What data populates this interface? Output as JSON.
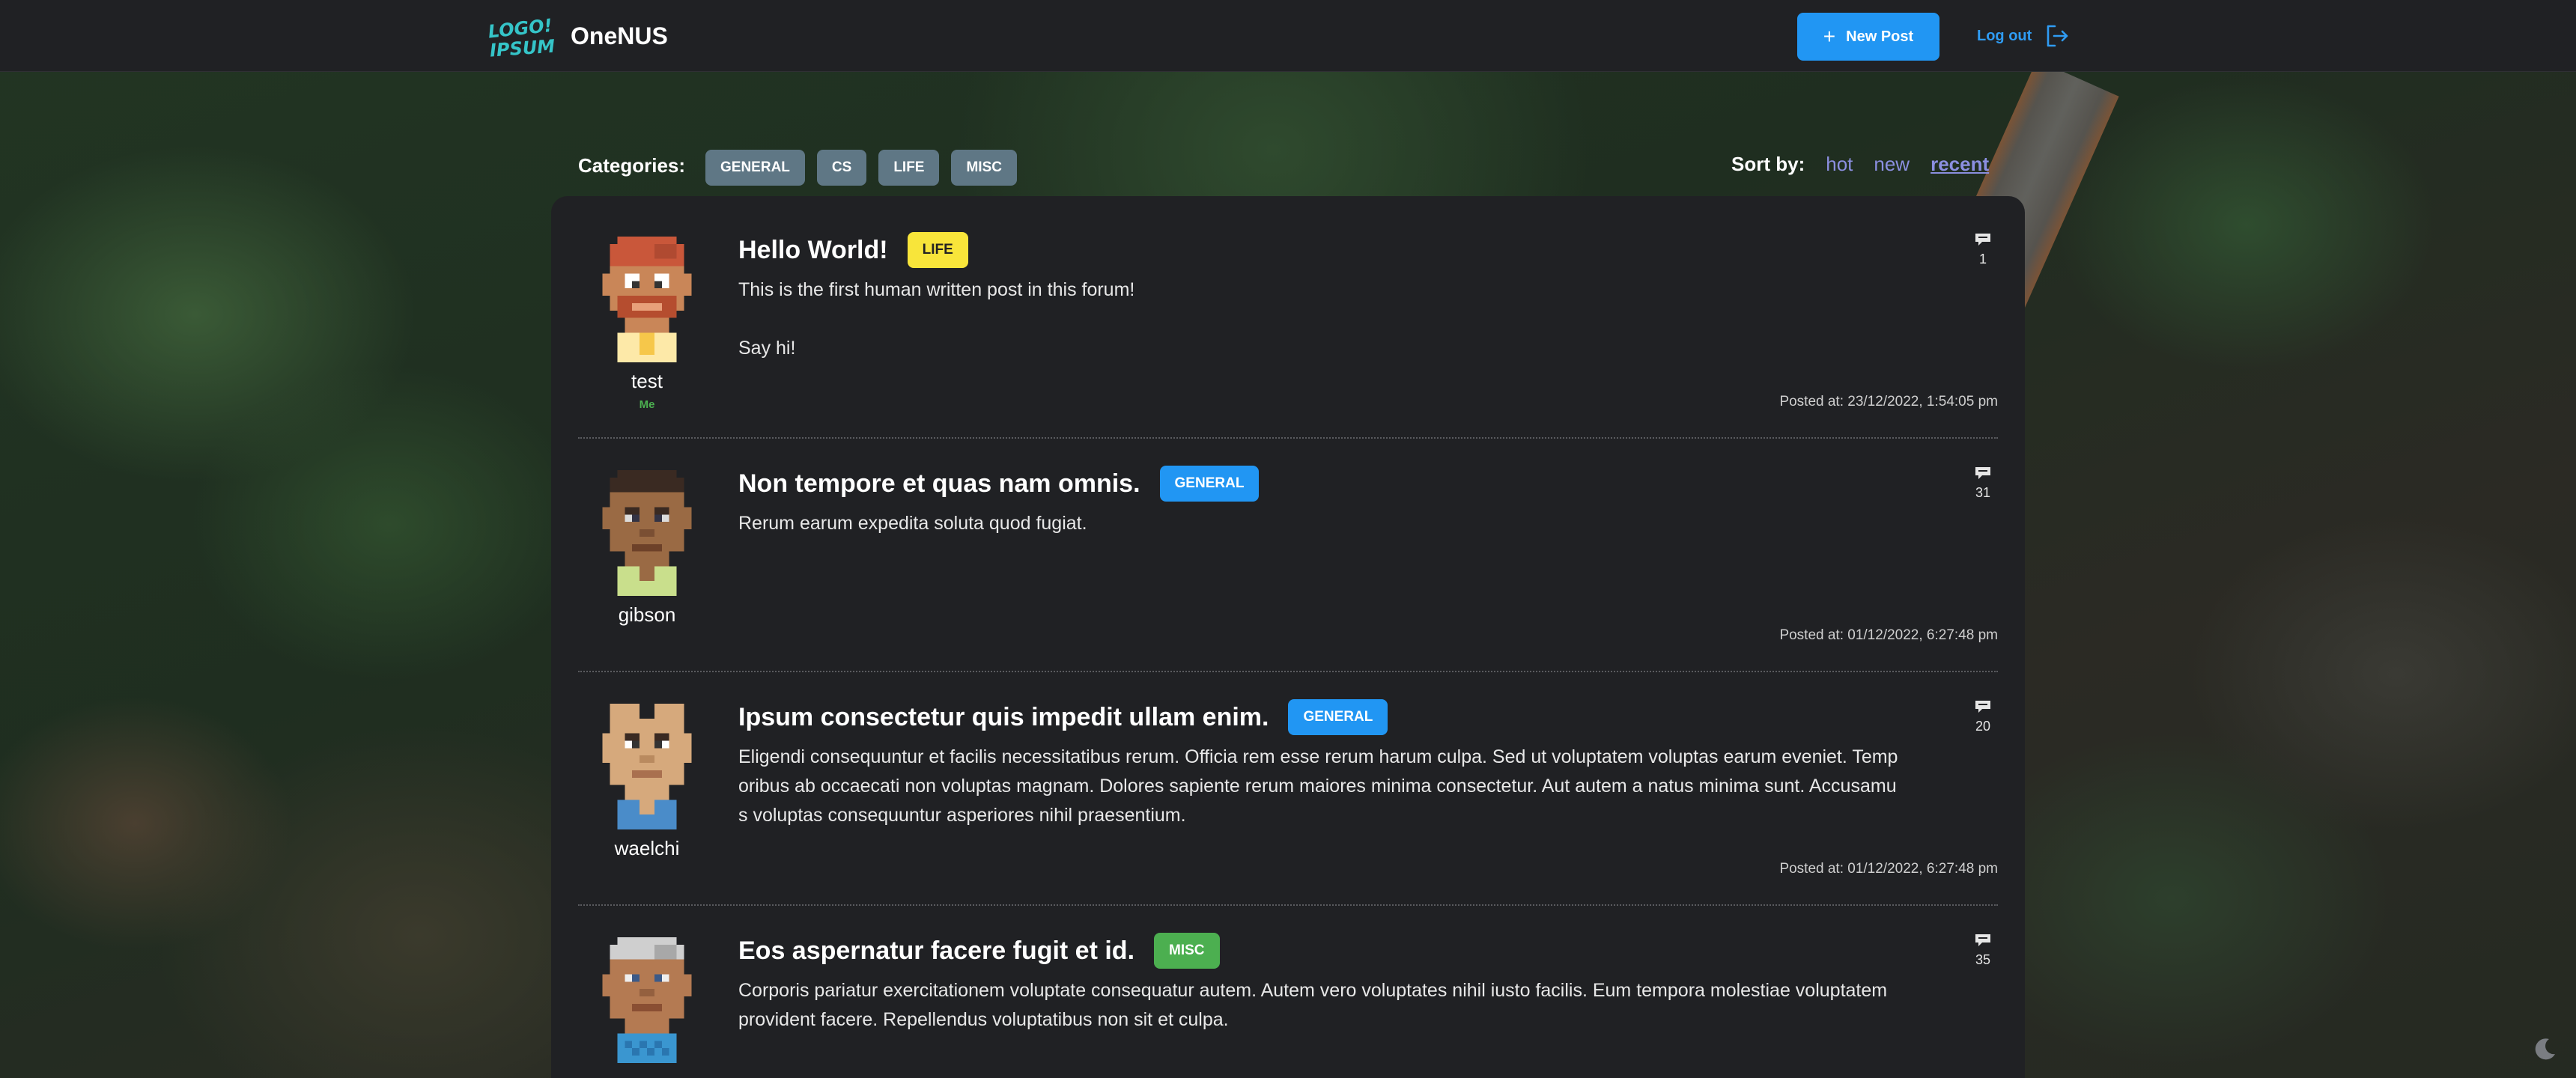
{
  "header": {
    "brand": "OneNUS",
    "new_post_label": "New Post",
    "logout_label": "Log out"
  },
  "filters": {
    "categories_label": "Categories:",
    "categories": [
      "GENERAL",
      "CS",
      "LIFE",
      "MISC"
    ],
    "sort_label": "Sort by:",
    "sort_options": [
      "hot",
      "new",
      "recent"
    ],
    "sort_active": "recent"
  },
  "posts": [
    {
      "title": "Hello World!",
      "tag": "LIFE",
      "body": "This is the first human written post in this forum!\n\nSay hi!",
      "username": "test",
      "me_label": "Me",
      "comments": "1",
      "posted": "Posted at: 23/12/2022, 1:54:05 pm"
    },
    {
      "title": "Non tempore et quas nam omnis.",
      "tag": "GENERAL",
      "body": "Rerum earum expedita soluta quod fugiat.",
      "username": "gibson",
      "comments": "31",
      "posted": "Posted at: 01/12/2022, 6:27:48 pm"
    },
    {
      "title": "Ipsum consectetur quis impedit ullam enim.",
      "tag": "GENERAL",
      "body": "Eligendi consequuntur et facilis necessitatibus rerum. Officia rem esse rerum harum culpa. Sed ut voluptatem voluptas earum eveniet. Temp\noribus ab occaecati non voluptas magnam. Dolores sapiente rerum maiores minima consectetur. Aut autem a natus minima sunt. Accusamu\ns voluptas consequuntur asperiores nihil praesentium.",
      "username": "waelchi",
      "comments": "20",
      "posted": "Posted at: 01/12/2022, 6:27:48 pm"
    },
    {
      "title": "Eos aspernatur facere fugit et id.",
      "tag": "MISC",
      "body": "Corporis pariatur exercitationem voluptate consequatur autem. Autem vero voluptates nihil iusto facilis. Eum tempora molestiae voluptatem\nprovident facere. Repellendus voluptatibus non sit et culpa.",
      "username": "",
      "comments": "35",
      "posted": ""
    }
  ],
  "colors": {
    "accent": "#2196f3",
    "tag_life": "#f8e53a",
    "tag_general": "#2196f3",
    "tag_misc": "#4caf50",
    "chip": "#5f7785",
    "sort_link": "#8b8fe0",
    "me": "#4caf50"
  },
  "icons": [
    "logo-icon",
    "plus-icon",
    "logout-icon",
    "comment-icon",
    "moon-icon"
  ]
}
